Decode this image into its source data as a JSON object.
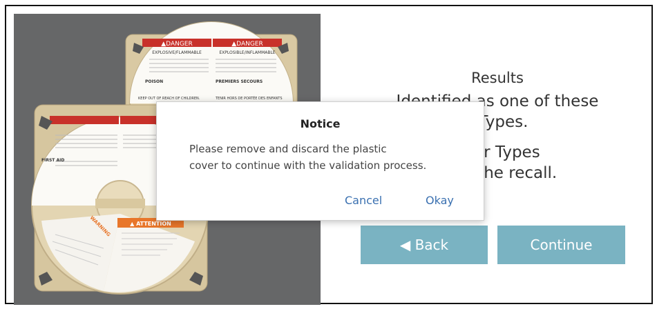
{
  "results": {
    "title": "Results",
    "line1": "Identified as one of these",
    "line2": "r Types.",
    "line3": "over Types",
    "line4": "d by the recall."
  },
  "buttons": {
    "back": "◀ Back",
    "continue": "Continue"
  },
  "dialog": {
    "title": "Notice",
    "message_line1": "Please remove and discard the plastic",
    "message_line2": "cover to continue with the validation process.",
    "cancel": "Cancel",
    "okay": "Okay"
  },
  "photo_labels": {
    "danger_en": "▲DANGER",
    "danger_fr": "▲DANGER",
    "explosive": "EXPLOSIVE/FLAMMABLE",
    "explosible": "EXPLOSIBLE/INFLAMMABLE",
    "poison": "POISON",
    "first_aid": "FIRST AID",
    "premiers_secours": "PREMIERS SECOURS",
    "keep_out": "KEEP OUT OF REACH OF CHILDREN.",
    "tenir": "TENIR HORS DE PORTÉE DES ENFANTS",
    "warning": "WARNING",
    "attention": "▲ ATTENTION"
  },
  "colors": {
    "button": "#7ab3c2",
    "link": "#3a70b0",
    "photo_bg": "#666768",
    "danger_red": "#c8312a",
    "attention_orange": "#e8762a"
  }
}
